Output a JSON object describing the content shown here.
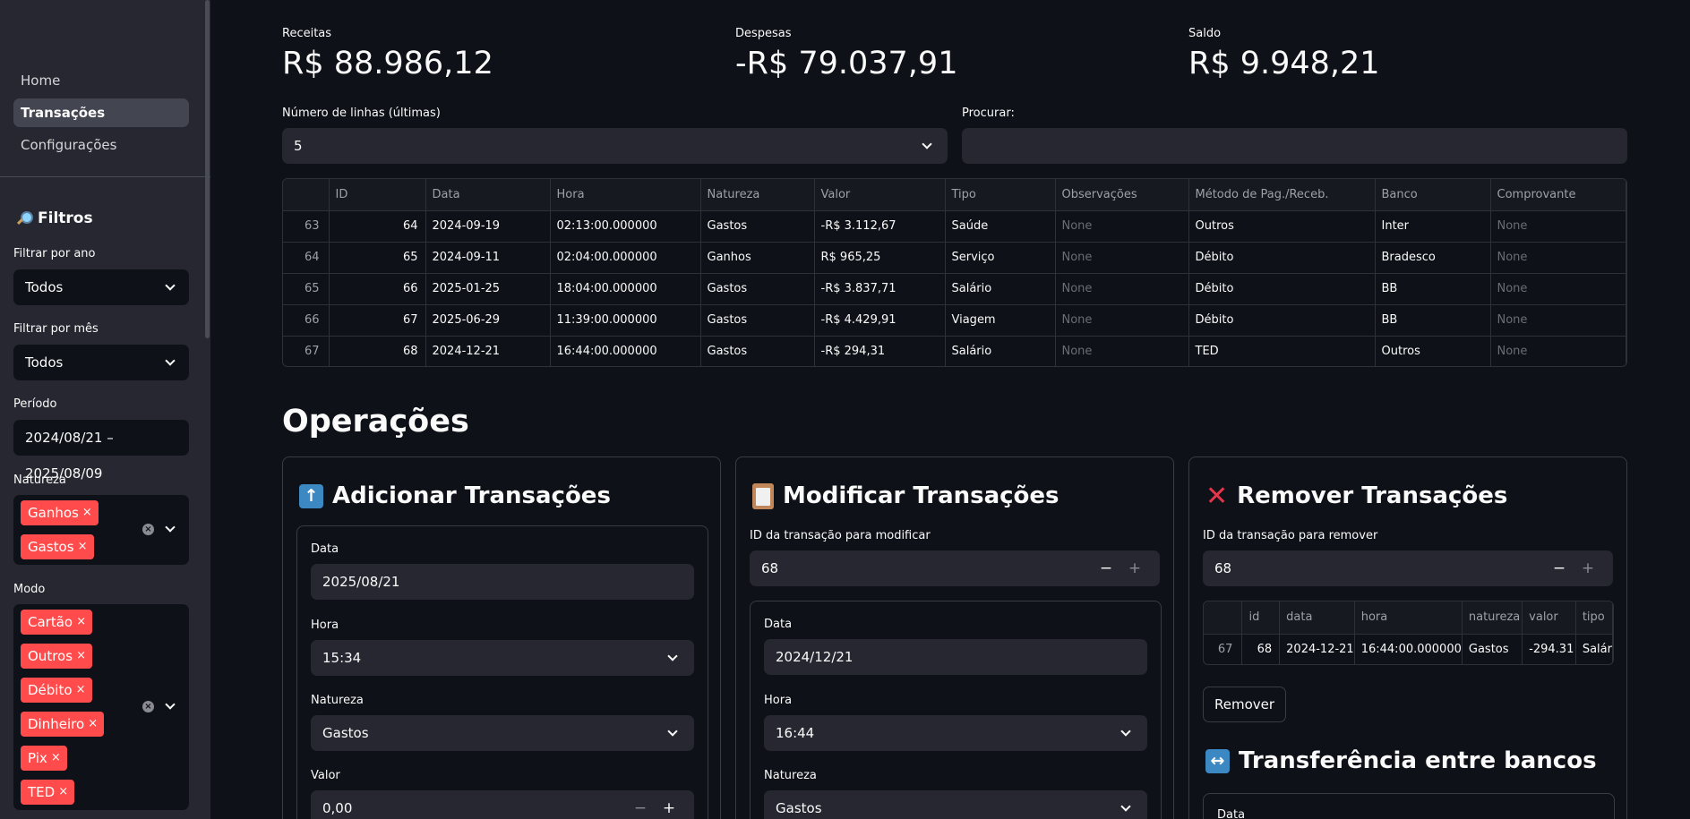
{
  "sidebar": {
    "nav": [
      "Home",
      "Transações",
      "Configurações"
    ],
    "filters_title": "Filtros",
    "year_label": "Filtrar por ano",
    "year_value": "Todos",
    "month_label": "Filtrar por mês",
    "month_value": "Todos",
    "period_label": "Período",
    "period_value": "2024/08/21 – 2025/08/09",
    "nature_label": "Natureza",
    "nature_chips": [
      "Ganhos",
      "Gastos"
    ],
    "mode_label": "Modo",
    "mode_chips": [
      "Cartão",
      "Outros",
      "Débito",
      "Dinheiro",
      "Pix",
      "TED"
    ],
    "chip_close": "×",
    "clear_icon": "×"
  },
  "metrics": {
    "income_label": "Receitas",
    "income_value": "R$ 88.986,12",
    "expenses_label": "Despesas",
    "expenses_value": "-R$ 79.037,91",
    "balance_label": "Saldo",
    "balance_value": "R$ 9.948,21"
  },
  "controls": {
    "rows_label": "Número de linhas (últimas)",
    "rows_value": "5",
    "search_label": "Procurar:",
    "search_value": ""
  },
  "table": {
    "columns": [
      "",
      "ID",
      "Data",
      "Hora",
      "Natureza",
      "Valor",
      "Tipo",
      "Observações",
      "Método de Pag./Receb.",
      "Banco",
      "Comprovante"
    ],
    "rows": [
      [
        "63",
        "64",
        "2024-09-19",
        "02:13:00.000000",
        "Gastos",
        "-R$ 3.112,67",
        "Saúde",
        "None",
        "Outros",
        "Inter",
        "None"
      ],
      [
        "64",
        "65",
        "2024-09-11",
        "02:04:00.000000",
        "Ganhos",
        "R$ 965,25",
        "Serviço",
        "None",
        "Débito",
        "Bradesco",
        "None"
      ],
      [
        "65",
        "66",
        "2025-01-25",
        "18:04:00.000000",
        "Gastos",
        "-R$ 3.837,71",
        "Salário",
        "None",
        "Débito",
        "BB",
        "None"
      ],
      [
        "66",
        "67",
        "2025-06-29",
        "11:39:00.000000",
        "Gastos",
        "-R$ 4.429,91",
        "Viagem",
        "None",
        "Débito",
        "BB",
        "None"
      ],
      [
        "67",
        "68",
        "2024-12-21",
        "16:44:00.000000",
        "Gastos",
        "-R$ 294,31",
        "Salário",
        "None",
        "TED",
        "Outros",
        "None"
      ]
    ]
  },
  "operations": {
    "title": "Operações",
    "add": {
      "title": "Adicionar Transações",
      "icon": "↑",
      "date_label": "Data",
      "date_value": "2025/08/21",
      "time_label": "Hora",
      "time_value": "15:34",
      "nature_label": "Natureza",
      "nature_value": "Gastos",
      "value_label": "Valor",
      "value_value": "0,00",
      "minus": "−",
      "plus": "+"
    },
    "modify": {
      "title": "Modificar Transações",
      "id_label": "ID da transação para modificar",
      "id_value": "68",
      "minus": "−",
      "plus": "+",
      "date_label": "Data",
      "date_value": "2024/12/21",
      "time_label": "Hora",
      "time_value": "16:44",
      "nature_label": "Natureza",
      "nature_value": "Gastos"
    },
    "remove": {
      "title": "Remover Transações",
      "icon": "✕",
      "id_label": "ID da transação para remover",
      "id_value": "68",
      "minus": "−",
      "plus": "+",
      "columns": [
        "",
        "id",
        "data",
        "hora",
        "natureza",
        "valor",
        "tipo"
      ],
      "row": [
        "67",
        "68",
        "2024-12-21",
        "16:44:00.000000",
        "Gastos",
        "-294.31",
        "Salár"
      ],
      "button": "Remover"
    },
    "transfer": {
      "title": "Transferência entre bancos",
      "icon": "↔",
      "date_label": "Data"
    }
  }
}
